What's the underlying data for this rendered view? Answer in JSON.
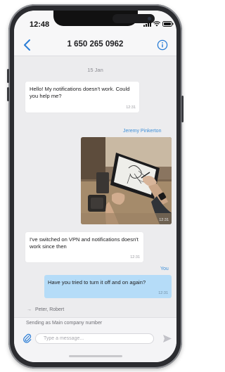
{
  "status_bar": {
    "time": "12:48"
  },
  "header": {
    "title": "1 650 265 0962"
  },
  "chat": {
    "date": "15 Jan",
    "messages": [
      {
        "direction": "incoming",
        "text": "Hello! My notifications doesn't work. Could you help me?",
        "time": "12:31"
      },
      {
        "direction": "outgoing",
        "sender": "Jeremy Pinkerton",
        "type": "image",
        "time": "12:31"
      },
      {
        "direction": "incoming",
        "text": "I've switched on VPN and notifications doesn't work since then",
        "time": "12:31"
      },
      {
        "direction": "outgoing",
        "sender": "You",
        "text": "Have you tried to turn it off and on again?",
        "time": "12:31"
      }
    ],
    "participants": "Peter, Robert"
  },
  "composer": {
    "sending_as": "Sending as Main company number",
    "placeholder": "Type a message..."
  },
  "colors": {
    "accent": "#3d8fd8",
    "outgoing_bubble": "#b5dcf8",
    "incoming_bubble": "#ffffff",
    "chat_background": "#ececee"
  }
}
